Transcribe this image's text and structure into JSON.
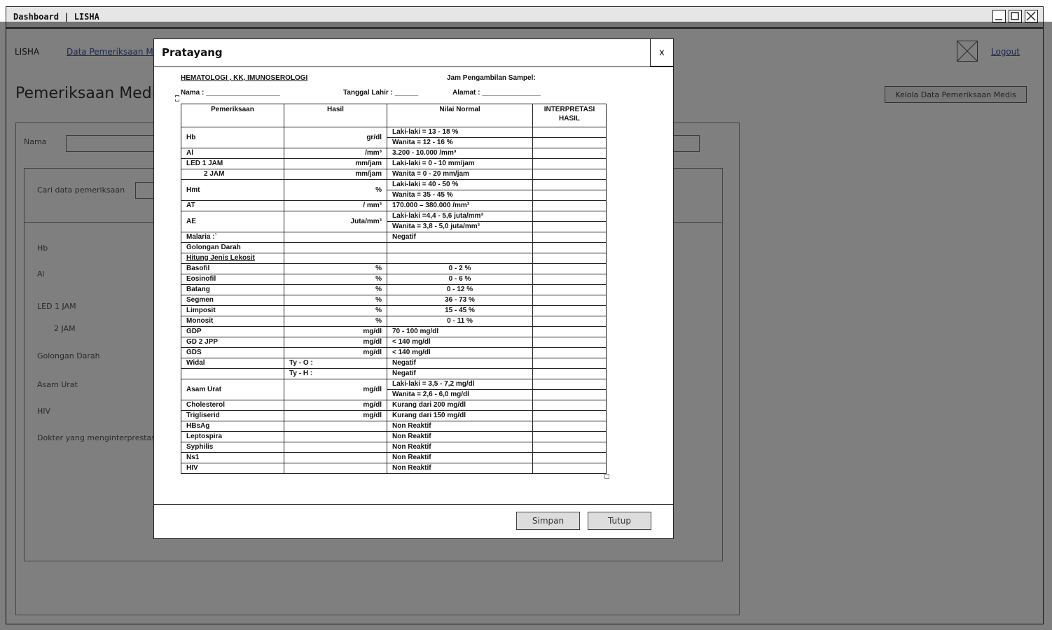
{
  "window": {
    "title": "Dashboard | LISHA"
  },
  "nav": {
    "brand": "LISHA",
    "link": "Data Pemeriksaan Medis",
    "logout": "Logout"
  },
  "page": {
    "title": "Pemeriksaan Medis",
    "kelola_button": "Kelola Data Pemeriksaan Medis",
    "name_label": "Nama",
    "search_label": "Cari data pemeriksaan",
    "field_labels": [
      "Hb",
      "Al",
      "LED 1 JAM",
      "2 JAM",
      "Golongan Darah",
      "Asam Urat",
      "HIV",
      "Dokter yang menginterprestasi"
    ]
  },
  "modal": {
    "title": "Pratayang",
    "close": "x",
    "save_button": "Simpan",
    "close_button": "Tutup",
    "doc": {
      "heading": "HEMATOLOGI , KK, IMUNOSEROLOGI",
      "jam": "Jam Pengambilan Sampel:",
      "nama": "Nama : ___________________",
      "tanggal": "Tanggal Lahir  : ______",
      "alamat": "Alamat : _______________",
      "headers": [
        "Pemeriksaan",
        "Hasil",
        "Nilai Normal",
        "INTERPRETASI HASIL"
      ],
      "rows": [
        [
          "Hb",
          "gr/dl",
          "Laki-laki = 13 - 18 %",
          ""
        ],
        [
          "",
          "",
          "Wanita  = 12 - 16 %",
          ""
        ],
        [
          "Al",
          "/mm³",
          "3.200 - 10.000 /mm³",
          ""
        ],
        [
          "LED  1 JAM",
          "mm/jam",
          "Laki-laki = 0 - 10 mm/jam",
          ""
        ],
        [
          "2 JAM",
          "mm/jam",
          "Wanita  = 0 - 20 mm/jam",
          ""
        ],
        [
          "Hmt",
          "%",
          "Laki-laki = 40 - 50 %",
          ""
        ],
        [
          "",
          "",
          "Wanita  = 35 - 45 %",
          ""
        ],
        [
          "AT",
          "/ mm³",
          "170.000 – 380.000 /mm³",
          ""
        ],
        [
          "AE",
          "Juta/mm³",
          "Laki-laki =4,4 - 5,6 juta/mm³",
          ""
        ],
        [
          "",
          "",
          "Wanita  = 3,8 - 5,0 juta/mm³",
          ""
        ],
        [
          "Malaria :`",
          "",
          "Negatif",
          ""
        ],
        [
          "Golongan Darah",
          "",
          "",
          ""
        ],
        [
          "Hitung Jenis Lekosit",
          "",
          "",
          ""
        ],
        [
          "Basofil",
          "%",
          "0 - 2 %",
          ""
        ],
        [
          "Eosinofil",
          "%",
          "0 - 6 %",
          ""
        ],
        [
          "Batang",
          "%",
          "0 - 12 %",
          ""
        ],
        [
          "Segmen",
          "%",
          "36 - 73 %",
          ""
        ],
        [
          "Limposit",
          "%",
          "15 - 45 %",
          ""
        ],
        [
          "Monosit",
          "%",
          "0 - 11 %",
          ""
        ],
        [
          "GDP",
          "mg/dl",
          "70 - 100 mg/dl",
          ""
        ],
        [
          "GD 2 JPP",
          "mg/dl",
          "< 140 mg/dl",
          ""
        ],
        [
          "GDS",
          "mg/dl",
          "< 140 mg/dl",
          ""
        ],
        [
          "Widal",
          "Ty - O :",
          "Negatif",
          ""
        ],
        [
          "",
          "Ty - H :",
          "Negatif",
          ""
        ],
        [
          "Asam Urat",
          "mg/dl",
          "Laki-laki = 3,5 - 7,2 mg/dl",
          ""
        ],
        [
          "",
          "",
          "Wanita  = 2,6 - 6,0 mg/dl",
          ""
        ],
        [
          "Cholesterol",
          "mg/dl",
          "Kurang dari 200 mg/dl",
          ""
        ],
        [
          "Trigliserid",
          "mg/dl",
          "Kurang dari 150 mg/dl",
          ""
        ],
        [
          "HBsAg",
          "",
          "Non Reaktif",
          ""
        ],
        [
          "Leptospira",
          "",
          "Non Reaktif",
          ""
        ],
        [
          "Syphilis",
          "",
          "Non Reaktif",
          ""
        ],
        [
          "Ns1",
          "",
          "Non Reaktif",
          ""
        ],
        [
          "HIV",
          "",
          "Non Reaktif",
          ""
        ]
      ]
    }
  }
}
